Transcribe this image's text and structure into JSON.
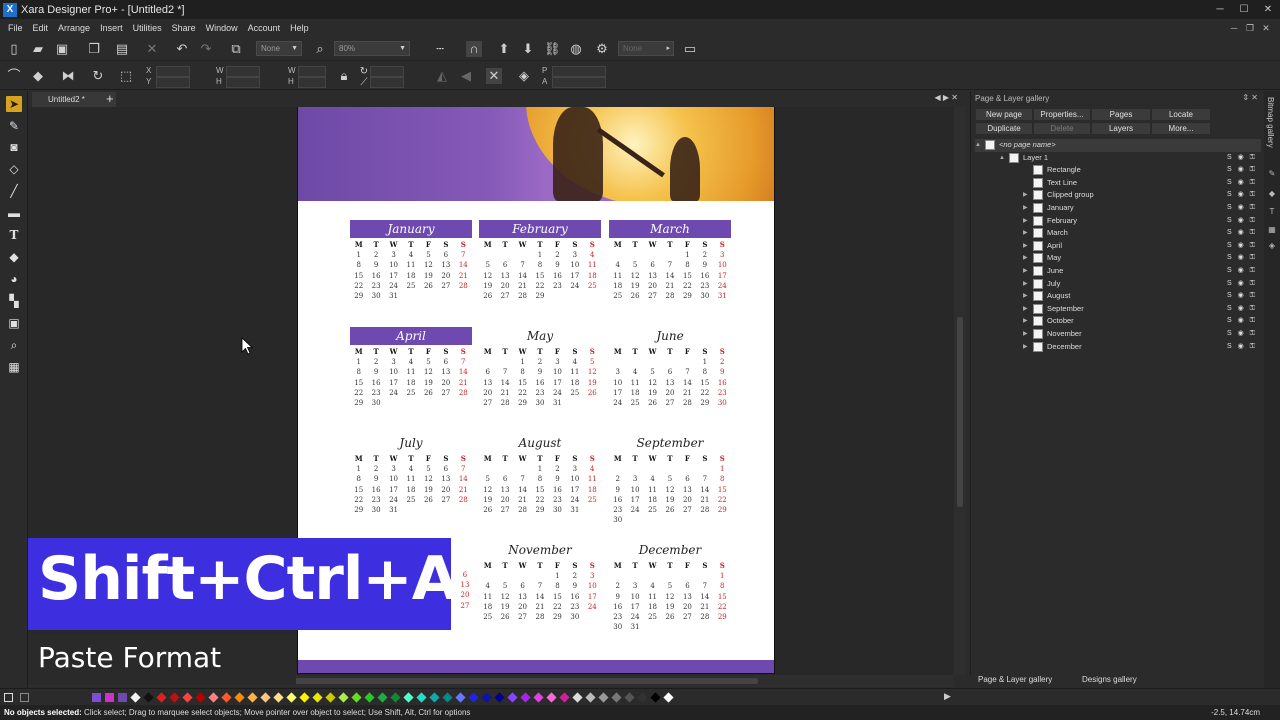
{
  "app": {
    "title": "Xara Designer Pro+ - [Untitled2 *]",
    "logo": "X"
  },
  "menu": [
    "File",
    "Edit",
    "Arrange",
    "Insert",
    "Utilities",
    "Share",
    "Window",
    "Account",
    "Help"
  ],
  "toolbar": {
    "fill_combo": "None",
    "zoom_combo": "80%",
    "right_combo": "None"
  },
  "toolbar2": {
    "x_label": "X",
    "y_label": "Y",
    "w_label": "W",
    "h_label": "H"
  },
  "doc_tab": {
    "label": "Untitled2 *"
  },
  "calendar": {
    "months": [
      {
        "name": "January",
        "filled": true,
        "days": [
          "1",
          "2",
          "3",
          "4",
          "5",
          "6",
          "7",
          "8",
          "9",
          "10",
          "11",
          "12",
          "13",
          "14",
          "15",
          "16",
          "17",
          "18",
          "19",
          "20",
          "21",
          "22",
          "23",
          "24",
          "25",
          "26",
          "27",
          "28",
          "29",
          "30",
          "31"
        ],
        "offset": 0
      },
      {
        "name": "February",
        "filled": true,
        "days": [
          "",
          "",
          "",
          "1",
          "2",
          "3",
          "4",
          "5",
          "6",
          "7",
          "8",
          "9",
          "10",
          "11",
          "12",
          "13",
          "14",
          "15",
          "16",
          "17",
          "18",
          "19",
          "20",
          "21",
          "22",
          "23",
          "24",
          "25",
          "26",
          "27",
          "28",
          "29"
        ],
        "offset": 0
      },
      {
        "name": "March",
        "filled": true,
        "days": [
          "",
          "",
          "",
          "",
          "1",
          "2",
          "3",
          "4",
          "5",
          "6",
          "7",
          "8",
          "9",
          "10",
          "11",
          "12",
          "13",
          "14",
          "15",
          "16",
          "17",
          "18",
          "19",
          "20",
          "21",
          "22",
          "23",
          "24",
          "25",
          "26",
          "27",
          "28",
          "29",
          "30",
          "31"
        ],
        "offset": 0
      },
      {
        "name": "April",
        "filled": true,
        "days": [
          "1",
          "2",
          "3",
          "4",
          "5",
          "6",
          "7",
          "8",
          "9",
          "10",
          "11",
          "12",
          "13",
          "14",
          "15",
          "16",
          "17",
          "18",
          "19",
          "20",
          "21",
          "22",
          "23",
          "24",
          "25",
          "26",
          "27",
          "28",
          "29",
          "30"
        ],
        "offset": 0
      },
      {
        "name": "May",
        "filled": false,
        "days": [
          "",
          "",
          "1",
          "2",
          "3",
          "4",
          "5",
          "6",
          "7",
          "8",
          "9",
          "10",
          "11",
          "12",
          "13",
          "14",
          "15",
          "16",
          "17",
          "18",
          "19",
          "20",
          "21",
          "22",
          "23",
          "24",
          "25",
          "26",
          "27",
          "28",
          "29",
          "30",
          "31"
        ],
        "offset": 0
      },
      {
        "name": "June",
        "filled": false,
        "days": [
          "",
          "",
          "",
          "",
          "",
          "1",
          "2",
          "3",
          "4",
          "5",
          "6",
          "7",
          "8",
          "9",
          "10",
          "11",
          "12",
          "13",
          "14",
          "15",
          "16",
          "17",
          "18",
          "19",
          "20",
          "21",
          "22",
          "23",
          "24",
          "25",
          "26",
          "27",
          "28",
          "29",
          "30"
        ],
        "offset": 0
      },
      {
        "name": "July",
        "filled": false,
        "days": [
          "1",
          "2",
          "3",
          "4",
          "5",
          "6",
          "7",
          "8",
          "9",
          "10",
          "11",
          "12",
          "13",
          "14",
          "15",
          "16",
          "17",
          "18",
          "19",
          "20",
          "21",
          "22",
          "23",
          "24",
          "25",
          "26",
          "27",
          "28",
          "29",
          "30",
          "31"
        ],
        "offset": 0
      },
      {
        "name": "August",
        "filled": false,
        "days": [
          "",
          "",
          "",
          "1",
          "2",
          "3",
          "4",
          "5",
          "6",
          "7",
          "8",
          "9",
          "10",
          "11",
          "12",
          "13",
          "14",
          "15",
          "16",
          "17",
          "18",
          "19",
          "20",
          "21",
          "22",
          "23",
          "24",
          "25",
          "26",
          "27",
          "28",
          "29",
          "30",
          "31"
        ],
        "offset": 0
      },
      {
        "name": "September",
        "filled": false,
        "days": [
          "",
          "",
          "",
          "",
          "",
          "",
          "1",
          "2",
          "3",
          "4",
          "5",
          "6",
          "7",
          "8",
          "9",
          "10",
          "11",
          "12",
          "13",
          "14",
          "15",
          "16",
          "17",
          "18",
          "19",
          "20",
          "21",
          "22",
          "23",
          "24",
          "25",
          "26",
          "27",
          "28",
          "29",
          "30"
        ],
        "offset": 0
      },
      {
        "name": "November",
        "filled": false,
        "days": [
          "",
          "",
          "",
          "",
          "1",
          "2",
          "3",
          "4",
          "5",
          "6",
          "7",
          "8",
          "9",
          "10",
          "11",
          "12",
          "13",
          "14",
          "15",
          "16",
          "17",
          "18",
          "19",
          "20",
          "21",
          "22",
          "23",
          "24",
          "25",
          "26",
          "27",
          "28",
          "29",
          "30"
        ],
        "offset": 0
      },
      {
        "name": "December",
        "filled": false,
        "days": [
          "",
          "",
          "",
          "",
          "",
          "",
          "1",
          "2",
          "3",
          "4",
          "5",
          "6",
          "7",
          "8",
          "9",
          "10",
          "11",
          "12",
          "13",
          "14",
          "15",
          "16",
          "17",
          "18",
          "19",
          "20",
          "21",
          "22",
          "23",
          "24",
          "25",
          "26",
          "27",
          "28",
          "29",
          "30",
          "31"
        ],
        "offset": 0
      }
    ],
    "dow": [
      "M",
      "T",
      "W",
      "T",
      "F",
      "S",
      "S"
    ],
    "partial_left_col": [
      "6",
      "13",
      "20",
      "27"
    ],
    "partial_left_col_sun": [
      "6",
      "13",
      "20",
      "27"
    ]
  },
  "gallery": {
    "title": "Page & Layer gallery",
    "buttons_row1": [
      "New page",
      "Properties...",
      "Pages",
      "Locate"
    ],
    "buttons_row2": [
      "Duplicate",
      "Delete",
      "Layers",
      "More..."
    ],
    "page_row": "<no page name>",
    "layer": "Layer 1",
    "items": [
      "Rectangle",
      "Text Line",
      "Clipped group",
      "January",
      "February",
      "March",
      "April",
      "May",
      "June",
      "July",
      "August",
      "September",
      "October",
      "November",
      "December"
    ],
    "side_tab": "Bitmap gallery",
    "bottom_tabs": [
      "Page & Layer gallery",
      "Designs gallery"
    ]
  },
  "status": {
    "bold": "No objects selected:",
    "text": " Click select; Drag to marquee select objects; Move pointer over object to select; Use Shift, Alt, Ctrl for options",
    "coords": "-2.5, 14.74cm"
  },
  "overlay": {
    "shortcut": "Shift+Ctrl+A",
    "description": "Paste Format"
  },
  "colors": {
    "accent_purple": "#6e49b0",
    "overlay_blue": "#3d2fe0",
    "sunday_red": "#c22222"
  }
}
